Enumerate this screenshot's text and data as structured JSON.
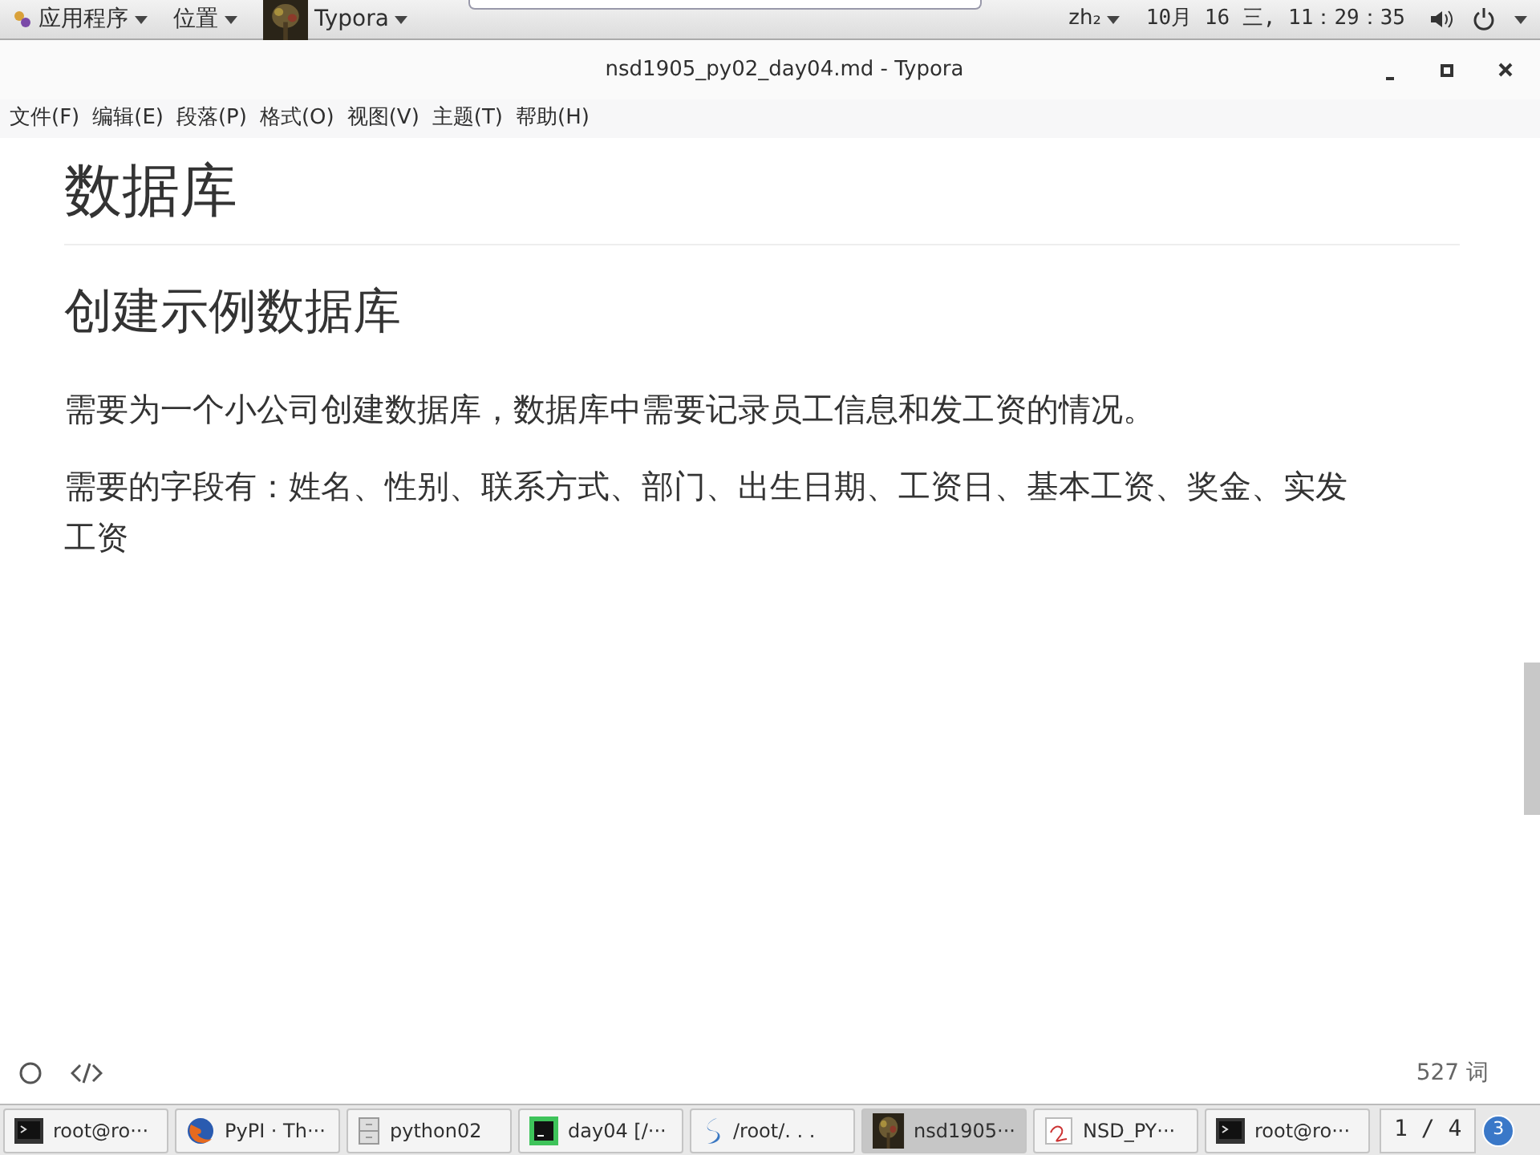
{
  "top_bar": {
    "menus": [
      {
        "label": "应用程序",
        "kind": "apps"
      },
      {
        "label": "位置",
        "kind": "plain"
      },
      {
        "label": "Typora",
        "kind": "app"
      }
    ],
    "input_method": "zh₂",
    "clock": "10月 16 三, 11：29：35"
  },
  "window": {
    "title": "nsd1905_py02_day04.md - Typora"
  },
  "menu_bar": [
    "文件(F)",
    "编辑(E)",
    "段落(P)",
    "格式(O)",
    "视图(V)",
    "主题(T)",
    "帮助(H)"
  ],
  "document": [
    {
      "kind": "h1",
      "text": "数据库"
    },
    {
      "kind": "h2",
      "text": "创建示例数据库"
    },
    {
      "kind": "p",
      "text": "需要为一个小公司创建数据库，数据库中需要记录员工信息和发工资的情况。"
    },
    {
      "kind": "p",
      "text": "需要的字段有：姓名、性别、联系方式、部门、出生日期、工资日、基本工资、奖金、实发工资"
    }
  ],
  "status_bar": {
    "word_count": "527 词"
  },
  "taskbar": {
    "items": [
      {
        "label": "root@ro···",
        "kind": "terminal",
        "selected": false
      },
      {
        "label": "PyPI · Th···",
        "kind": "browser",
        "selected": false
      },
      {
        "label": "python02",
        "kind": "folder",
        "selected": false
      },
      {
        "label": "day04 [/···",
        "kind": "ide",
        "selected": false
      },
      {
        "label": "/root/. . .",
        "kind": "swirl",
        "selected": false
      },
      {
        "label": "nsd1905···",
        "kind": "picture",
        "selected": true
      },
      {
        "label": "NSD_PY···",
        "kind": "document",
        "selected": false
      },
      {
        "label": "root@ro···",
        "kind": "terminal",
        "selected": false
      }
    ],
    "pager": "1 / 4",
    "badge": "3"
  }
}
